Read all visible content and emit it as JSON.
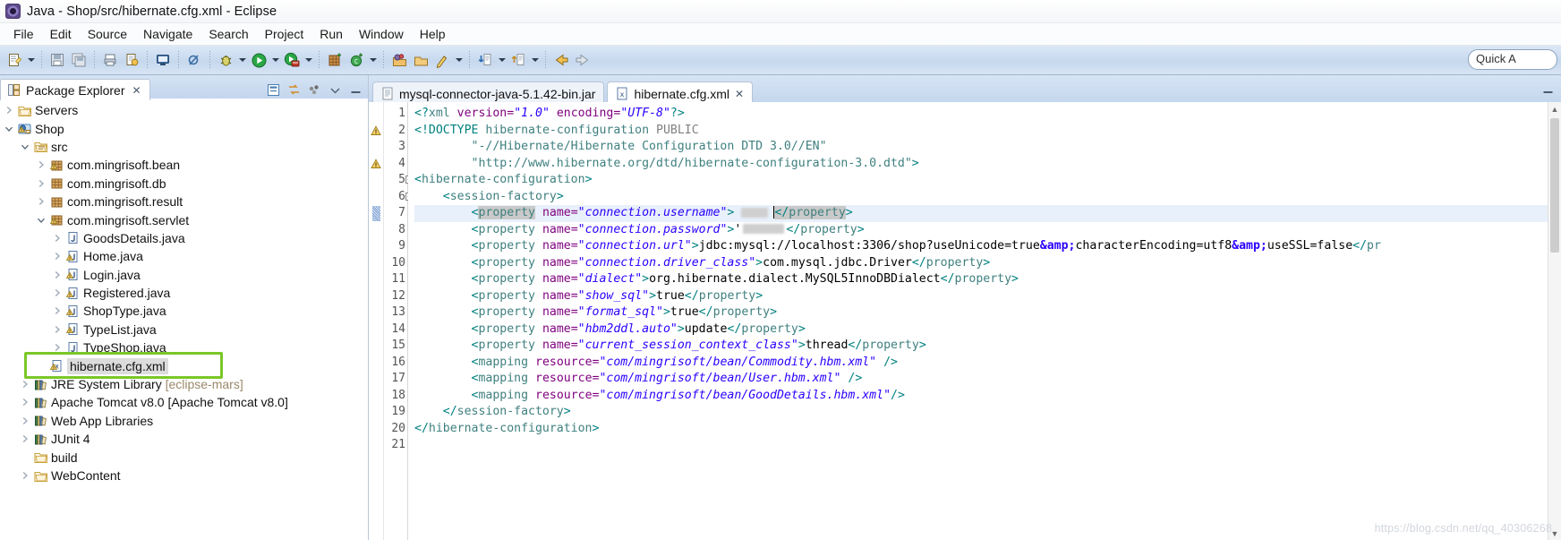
{
  "window": {
    "title": "Java - Shop/src/hibernate.cfg.xml - Eclipse",
    "logo_icon": "eclipse-logo-icon"
  },
  "menubar": {
    "items": [
      {
        "label": "File"
      },
      {
        "label": "Edit"
      },
      {
        "label": "Source"
      },
      {
        "label": "Navigate"
      },
      {
        "label": "Search"
      },
      {
        "label": "Project"
      },
      {
        "label": "Run"
      },
      {
        "label": "Window"
      },
      {
        "label": "Help"
      }
    ]
  },
  "toolbar": {
    "quick_access_text": "Quick A",
    "buttons": [
      {
        "name": "new-wizard-icon"
      },
      {
        "name": "new-wizard-dropdown-icon"
      },
      {
        "name": "save-icon"
      },
      {
        "name": "save-all-icon"
      },
      {
        "name": "print-icon"
      },
      {
        "name": "export-icon"
      },
      {
        "name": "toggle-console-icon"
      },
      {
        "name": "skip-breakpoints-icon"
      },
      {
        "name": "debug-icon"
      },
      {
        "name": "debug-dropdown-icon"
      },
      {
        "name": "run-icon"
      },
      {
        "name": "run-dropdown-icon"
      },
      {
        "name": "run-server-icon"
      },
      {
        "name": "run-server-dropdown-icon"
      },
      {
        "name": "new-java-package-icon"
      },
      {
        "name": "new-java-class-icon"
      },
      {
        "name": "new-class-dropdown-icon"
      },
      {
        "name": "open-type-icon"
      },
      {
        "name": "open-task-icon"
      },
      {
        "name": "search-icon"
      },
      {
        "name": "search-dropdown-icon"
      },
      {
        "name": "next-annotation-icon"
      },
      {
        "name": "next-annotation-dropdown-icon"
      },
      {
        "name": "previous-annotation-icon"
      },
      {
        "name": "previous-annotation-dropdown-icon"
      },
      {
        "name": "back-icon"
      },
      {
        "name": "forward-icon"
      }
    ]
  },
  "package_explorer": {
    "tab_label": "Package Explorer",
    "tab_close_icon": "close-icon",
    "tools": [
      {
        "name": "collapse-all-icon"
      },
      {
        "name": "link-with-editor-icon"
      },
      {
        "name": "view-menu-dots-icon"
      },
      {
        "name": "view-menu-chevron-icon"
      },
      {
        "name": "minimize-view-icon"
      }
    ],
    "tree": [
      {
        "label": "Servers",
        "indent": 0,
        "twisty": ">",
        "icon": "folder-icon",
        "warn": false
      },
      {
        "label": "Shop",
        "indent": 0,
        "twisty": "v",
        "icon": "web-project-icon",
        "warn": true
      },
      {
        "label": "src",
        "indent": 1,
        "twisty": "v",
        "icon": "source-folder-icon",
        "warn": false
      },
      {
        "label": "com.mingrisoft.bean",
        "indent": 2,
        "twisty": ">",
        "icon": "package-icon",
        "warn": true
      },
      {
        "label": "com.mingrisoft.db",
        "indent": 2,
        "twisty": ">",
        "icon": "package-icon",
        "warn": false
      },
      {
        "label": "com.mingrisoft.result",
        "indent": 2,
        "twisty": ">",
        "icon": "package-icon",
        "warn": false
      },
      {
        "label": "com.mingrisoft.servlet",
        "indent": 2,
        "twisty": "v",
        "icon": "package-icon",
        "warn": true
      },
      {
        "label": "GoodsDetails.java",
        "indent": 3,
        "twisty": ">",
        "icon": "java-file-icon",
        "warn": false
      },
      {
        "label": "Home.java",
        "indent": 3,
        "twisty": ">",
        "icon": "java-file-icon",
        "warn": true
      },
      {
        "label": "Login.java",
        "indent": 3,
        "twisty": ">",
        "icon": "java-file-icon",
        "warn": true
      },
      {
        "label": "Registered.java",
        "indent": 3,
        "twisty": ">",
        "icon": "java-file-icon",
        "warn": true
      },
      {
        "label": "ShopType.java",
        "indent": 3,
        "twisty": ">",
        "icon": "java-file-icon",
        "warn": true
      },
      {
        "label": "TypeList.java",
        "indent": 3,
        "twisty": ">",
        "icon": "java-file-icon",
        "warn": true
      },
      {
        "label": "TypeShop.java",
        "indent": 3,
        "twisty": ">",
        "icon": "java-file-icon",
        "warn": false
      },
      {
        "label": "hibernate.cfg.xml",
        "indent": 2,
        "twisty": "",
        "icon": "xml-file-icon",
        "warn": true,
        "selected": true,
        "highlighted": true
      },
      {
        "label": "JRE System Library",
        "sublabel": "[eclipse-mars]",
        "indent": 1,
        "twisty": ">",
        "icon": "library-icon",
        "warn": false
      },
      {
        "label": "Apache Tomcat v8.0 [Apache Tomcat v8.0]",
        "indent": 1,
        "twisty": ">",
        "icon": "library-icon",
        "warn": false
      },
      {
        "label": "Web App Libraries",
        "indent": 1,
        "twisty": ">",
        "icon": "library-icon",
        "warn": false
      },
      {
        "label": "JUnit 4",
        "indent": 1,
        "twisty": ">",
        "icon": "library-icon",
        "warn": false
      },
      {
        "label": "build",
        "indent": 1,
        "twisty": "",
        "icon": "folder-icon",
        "warn": false
      },
      {
        "label": "WebContent",
        "indent": 1,
        "twisty": ">",
        "icon": "folder-icon",
        "warn": false
      }
    ]
  },
  "editor": {
    "tabs": [
      {
        "label": "mysql-connector-java-5.1.42-bin.jar",
        "icon": "jar-file-icon",
        "active": false,
        "closeable": false
      },
      {
        "label": "hibernate.cfg.xml",
        "icon": "xml-file-icon",
        "active": true,
        "closeable": true,
        "close_icon": "close-icon"
      }
    ],
    "restore_icon": "restore-view-icon",
    "lines": [
      {
        "n": 1,
        "marker": "",
        "fold": "",
        "current": false
      },
      {
        "n": 2,
        "marker": "warn",
        "fold": "",
        "current": false
      },
      {
        "n": 3,
        "marker": "",
        "fold": "",
        "current": false
      },
      {
        "n": 4,
        "marker": "warn",
        "fold": "",
        "current": false
      },
      {
        "n": 5,
        "marker": "",
        "fold": "-",
        "current": false
      },
      {
        "n": 6,
        "marker": "",
        "fold": "-",
        "current": false
      },
      {
        "n": 7,
        "marker": "edit",
        "fold": "",
        "current": true
      },
      {
        "n": 8,
        "marker": "",
        "fold": "",
        "current": false
      },
      {
        "n": 9,
        "marker": "",
        "fold": "",
        "current": false
      },
      {
        "n": 10,
        "marker": "",
        "fold": "",
        "current": false
      },
      {
        "n": 11,
        "marker": "",
        "fold": "",
        "current": false
      },
      {
        "n": 12,
        "marker": "",
        "fold": "",
        "current": false
      },
      {
        "n": 13,
        "marker": "",
        "fold": "",
        "current": false
      },
      {
        "n": 14,
        "marker": "",
        "fold": "",
        "current": false
      },
      {
        "n": 15,
        "marker": "",
        "fold": "",
        "current": false
      },
      {
        "n": 16,
        "marker": "",
        "fold": "",
        "current": false
      },
      {
        "n": 17,
        "marker": "",
        "fold": "",
        "current": false
      },
      {
        "n": 18,
        "marker": "",
        "fold": "",
        "current": false
      },
      {
        "n": 19,
        "marker": "",
        "fold": "",
        "current": false
      },
      {
        "n": 20,
        "marker": "",
        "fold": "",
        "current": false
      },
      {
        "n": 21,
        "marker": "",
        "fold": "",
        "current": false
      }
    ],
    "code": {
      "l1": "<?xml version=\"1.0\" encoding=\"UTF-8\"?>",
      "l2": "<!DOCTYPE hibernate-configuration PUBLIC",
      "l3": "        \"-//Hibernate/Hibernate Configuration DTD 3.0//EN\"",
      "l4": "        \"http://www.hibernate.org/dtd/hibernate-configuration-3.0.dtd\">",
      "l5": "<hibernate-configuration>",
      "l6": "    <session-factory>",
      "l7": "        <property name=\"connection.username\">    </property>",
      "l8": "        <property name=\"connection.password\">     </property>",
      "l9": "        <property name=\"connection.url\">jdbc:mysql://localhost:3306/shop?useUnicode=true&amp;characterEncoding=utf8&amp;useSSL=false</pr",
      "l10": "        <property name=\"connection.driver_class\">com.mysql.jdbc.Driver</property>",
      "l11": "        <property name=\"dialect\">org.hibernate.dialect.MySQL5InnoDBDialect</property>",
      "l12": "        <property name=\"show_sql\">true</property>",
      "l13": "        <property name=\"format_sql\">true</property>",
      "l14": "        <property name=\"hbm2ddl.auto\">update</property>",
      "l15": "        <property name=\"current_session_context_class\">thread</property>",
      "l16": "        <mapping resource=\"com/mingrisoft/bean/Commodity.hbm.xml\" />",
      "l17": "        <mapping resource=\"com/mingrisoft/bean/User.hbm.xml\" />",
      "l18": "        <mapping resource=\"com/mingrisoft/bean/GoodDetails.hbm.xml\"/>",
      "l19": "    </session-factory>",
      "l20": "</hibernate-configuration>",
      "l21": ""
    }
  },
  "watermark": {
    "text": "https://blog.csdn.net/qq_40306268"
  },
  "colors": {
    "tag": "#3f7f7f",
    "attribute": "#7f007f",
    "attribute_value": "#2a00ff",
    "text": "#000000",
    "current_line": "#e8f0fb",
    "highlight_box": "#7ac728",
    "toolbar_bg": "#c6d8ee"
  }
}
